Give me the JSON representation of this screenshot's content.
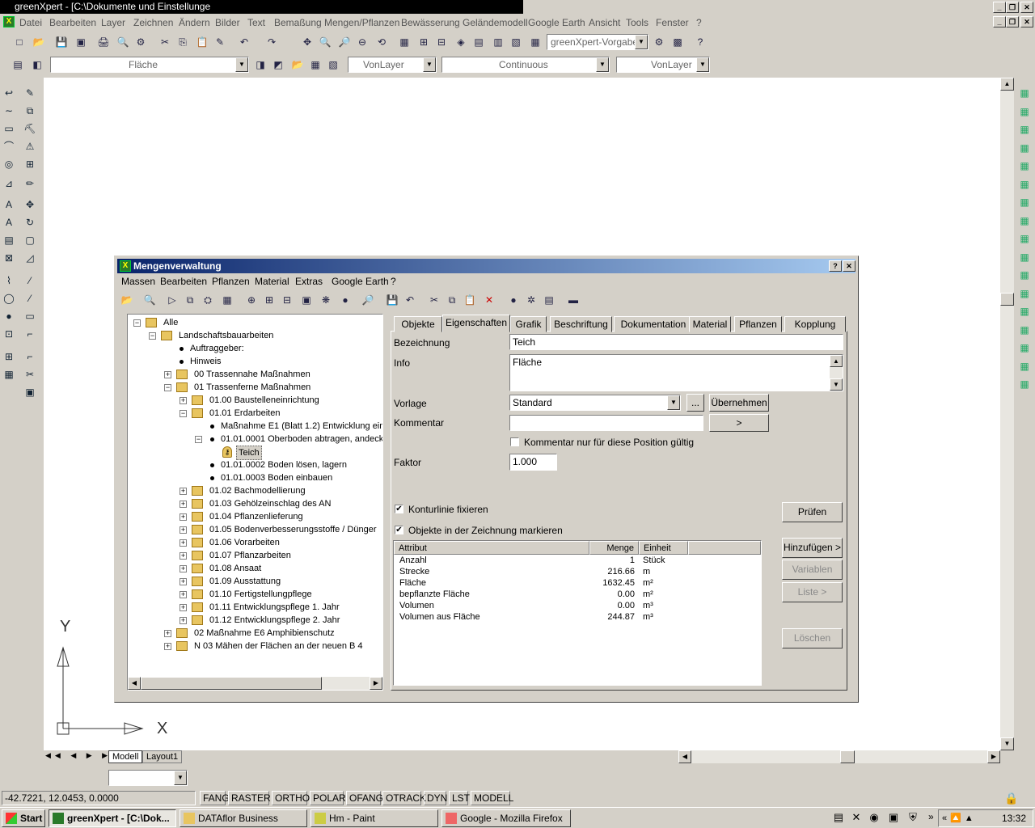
{
  "window": {
    "title": "greenXpert - [C:\\Dokumente und Einstellunge",
    "menu": [
      "Datei",
      "Bearbeiten",
      "Layer",
      "Zeichnen",
      "Ändern",
      "Bilder",
      "Text",
      "Bemaßung",
      "Mengen/Pflanzen",
      "Bewässerung",
      "Geländemodell",
      "Google Earth",
      "Ansicht",
      "Tools",
      "Fenster",
      "?"
    ]
  },
  "toolbar": {
    "style_combo": "greenXpert-Vorgabe",
    "layer_combo": "Fläche",
    "color_combo": "VonLayer",
    "linetype_combo": "Continuous",
    "lineweight_combo": "VonLayer"
  },
  "canvas": {
    "axis_y": "Y",
    "axis_x": "X",
    "tabs": [
      "Modell",
      "Layout1"
    ]
  },
  "dialog": {
    "title": "Mengenverwaltung",
    "help": "?",
    "close": "✕",
    "menu": [
      "Massen",
      "Bearbeiten",
      "Pflanzen",
      "Material",
      "Extras",
      "Google Earth",
      "?"
    ],
    "tree": [
      {
        "label": "Alle",
        "level": 0,
        "exp": "−",
        "icon": "folder"
      },
      {
        "label": "Landschaftsbauarbeiten",
        "level": 1,
        "exp": "−",
        "icon": "pkg"
      },
      {
        "label": "Auftraggeber:",
        "level": 2,
        "icon": "dot"
      },
      {
        "label": "Hinweis",
        "level": 2,
        "icon": "dot"
      },
      {
        "label": "00 Trassennahe Maßnahmen",
        "level": 2,
        "exp": "+",
        "icon": "pkg"
      },
      {
        "label": "01 Trassenferne Maßnahmen",
        "level": 2,
        "exp": "−",
        "icon": "pkg"
      },
      {
        "label": "01.00 Baustelleneinrichtung",
        "level": 3,
        "exp": "+",
        "icon": "pkg"
      },
      {
        "label": "01.01 Erdarbeiten",
        "level": 3,
        "exp": "−",
        "icon": "pkg"
      },
      {
        "label": "Maßnahme E1 (Blatt 1.2) Entwicklung ein",
        "level": 4,
        "icon": "dot"
      },
      {
        "label": "01.01.0001 Oberboden abtragen, andeck",
        "level": 4,
        "exp": "−",
        "icon": "dot"
      },
      {
        "label": "Teich",
        "level": 5,
        "icon": "key",
        "selected": true
      },
      {
        "label": "01.01.0002 Boden lösen, lagern",
        "level": 4,
        "icon": "dot"
      },
      {
        "label": "01.01.0003 Boden einbauen",
        "level": 4,
        "icon": "dot"
      },
      {
        "label": "01.02 Bachmodellierung",
        "level": 3,
        "exp": "+",
        "icon": "pkg"
      },
      {
        "label": "01.03 Gehölzeinschlag des AN",
        "level": 3,
        "exp": "+",
        "icon": "pkg"
      },
      {
        "label": "01.04 Pflanzenlieferung",
        "level": 3,
        "exp": "+",
        "icon": "pkg"
      },
      {
        "label": "01.05 Bodenverbesserungsstoffe / Dünger",
        "level": 3,
        "exp": "+",
        "icon": "pkg"
      },
      {
        "label": "01.06 Vorarbeiten",
        "level": 3,
        "exp": "+",
        "icon": "pkg"
      },
      {
        "label": "01.07 Pflanzarbeiten",
        "level": 3,
        "exp": "+",
        "icon": "pkg"
      },
      {
        "label": "01.08 Ansaat",
        "level": 3,
        "exp": "+",
        "icon": "pkg"
      },
      {
        "label": "01.09 Ausstattung",
        "level": 3,
        "exp": "+",
        "icon": "pkg"
      },
      {
        "label": "01.10 Fertigstellungpflege",
        "level": 3,
        "exp": "+",
        "icon": "pkg"
      },
      {
        "label": "01.11 Entwicklungspflege 1. Jahr",
        "level": 3,
        "exp": "+",
        "icon": "pkg"
      },
      {
        "label": "01.12 Entwicklungspflege 2. Jahr",
        "level": 3,
        "exp": "+",
        "icon": "pkg"
      },
      {
        "label": "02 Maßnahme E6 Amphibienschutz",
        "level": 2,
        "exp": "+",
        "icon": "pkg"
      },
      {
        "label": "N 03 Mähen der Flächen an der neuen B 4",
        "level": 2,
        "exp": "+",
        "icon": "pkg"
      }
    ],
    "tabs": [
      "Objekte",
      "Eigenschaften",
      "Grafik",
      "Beschriftung",
      "Dokumentation",
      "Material",
      "Pflanzen",
      "Kopplung"
    ],
    "active_tab": "Eigenschaften",
    "form": {
      "bezeichnung_label": "Bezeichnung",
      "bezeichnung_value": "Teich",
      "info_label": "Info",
      "info_value": "Fläche",
      "vorlage_label": "Vorlage",
      "vorlage_value": "Standard",
      "dots_btn": "...",
      "uebernehmen_btn": "Übernehmen",
      "kommentar_label": "Kommentar",
      "kommentar_value": "",
      "arrow_btn": ">",
      "kommentar_check": "Kommentar nur für diese Position gültig",
      "faktor_label": "Faktor",
      "faktor_value": "1.000",
      "kontur_check": "Konturlinie fixieren",
      "markieren_check": "Objekte in der Zeichnung markieren"
    },
    "buttons": {
      "pruefen": "Prüfen",
      "hinzufuegen": "Hinzufügen >",
      "variablen": "Variablen",
      "liste": "Liste >",
      "loeschen": "Löschen"
    },
    "table": {
      "headers": [
        "Attribut",
        "Menge",
        "Einheit"
      ],
      "rows": [
        [
          "Anzahl",
          "1",
          "Stück"
        ],
        [
          "Strecke",
          "216.66",
          "m"
        ],
        [
          "Fläche",
          "1632.45",
          "m²"
        ],
        [
          "bepflanzte Fläche",
          "0.00",
          "m²"
        ],
        [
          "Volumen",
          "0.00",
          "m³"
        ],
        [
          "Volumen aus Fläche",
          "244.87",
          "m³"
        ]
      ]
    }
  },
  "statusbar": {
    "coords": "-42.7221, 12.0453, 0.0000",
    "toggles": [
      "FANG",
      "RASTER",
      "ORTHO",
      "POLAR",
      "OFANG",
      "OTRACK",
      "DYN",
      "LST",
      "MODELL"
    ]
  },
  "taskbar": {
    "start": "Start",
    "tasks": [
      "greenXpert - [C:\\Dok...",
      "DATAflor Business",
      "Hm - Paint",
      "Google - Mozilla Firefox"
    ],
    "clock": "13:32"
  }
}
